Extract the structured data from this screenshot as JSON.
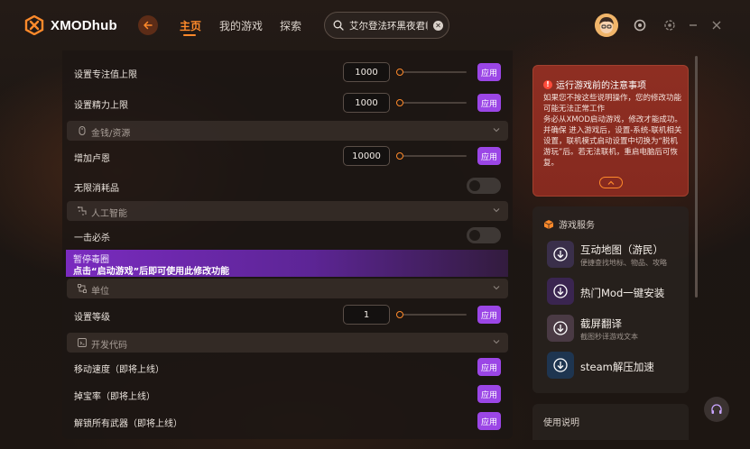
{
  "header": {
    "brand": "XMODhub",
    "nav": [
      {
        "label": "主页",
        "active": true
      },
      {
        "label": "我的游戏",
        "active": false
      },
      {
        "label": "探索",
        "active": false
      }
    ],
    "search_value": "艾尔登法环黑夜君临"
  },
  "mods": {
    "rows": {
      "focus_limit": {
        "label": "设置专注值上限",
        "value": "1000",
        "apply": "应用"
      },
      "stamina_limit": {
        "label": "设置精力上限",
        "value": "1000",
        "apply": "应用"
      },
      "add_runes": {
        "label": "增加卢恩",
        "value": "10000",
        "apply": "应用"
      },
      "infinite_consumables": {
        "label": "无限消耗品"
      },
      "one_hit_kill": {
        "label": "一击必杀"
      },
      "set_level": {
        "label": "设置等级",
        "value": "1",
        "apply": "应用"
      },
      "move_speed": {
        "label": "移动速度（即将上线）",
        "apply": "应用"
      },
      "drop_rate": {
        "label": "掉宝率（即将上线）",
        "apply": "应用"
      },
      "unlock_weapons": {
        "label": "解锁所有武器（即将上线）",
        "apply": "应用"
      }
    },
    "sections": {
      "money": "金钱/资源",
      "ai": "人工智能",
      "unit": "单位",
      "dev": "开发代码"
    },
    "notice": {
      "title": "暂停毒圈",
      "text": "点击“启动游戏”后即可使用此修改功能"
    }
  },
  "warning": {
    "title": "运行游戏前的注意事项",
    "body": "如果您不按这些说明操作，您的修改功能可能无法正常工作\n务必从XMOD启动游戏，修改才能成功。\n并确保 进入游戏后，设置-系统-联机相关设置，联机模式启动设置中切换为“脱机游玩”后。若无法联机，重启电脑后可恢复。"
  },
  "services": {
    "title": "游戏服务",
    "items": [
      {
        "title": "互动地图（游民）",
        "subtitle": "便捷查找地标、物品、攻略",
        "icon": "download-circle-icon"
      },
      {
        "title": "热门Mod一键安装",
        "subtitle": "",
        "icon": "download-circle-icon"
      },
      {
        "title": "截屏翻译",
        "subtitle": "截图秒译游戏文本",
        "icon": "download-circle-icon"
      },
      {
        "title": "steam解压加速",
        "subtitle": "",
        "icon": "download-circle-icon"
      }
    ]
  },
  "usage": {
    "title": "使用说明"
  },
  "colors": {
    "accent": "#ff8a2b",
    "apply_button": "#9b46e6",
    "warning_bg": "#8e2e22"
  }
}
